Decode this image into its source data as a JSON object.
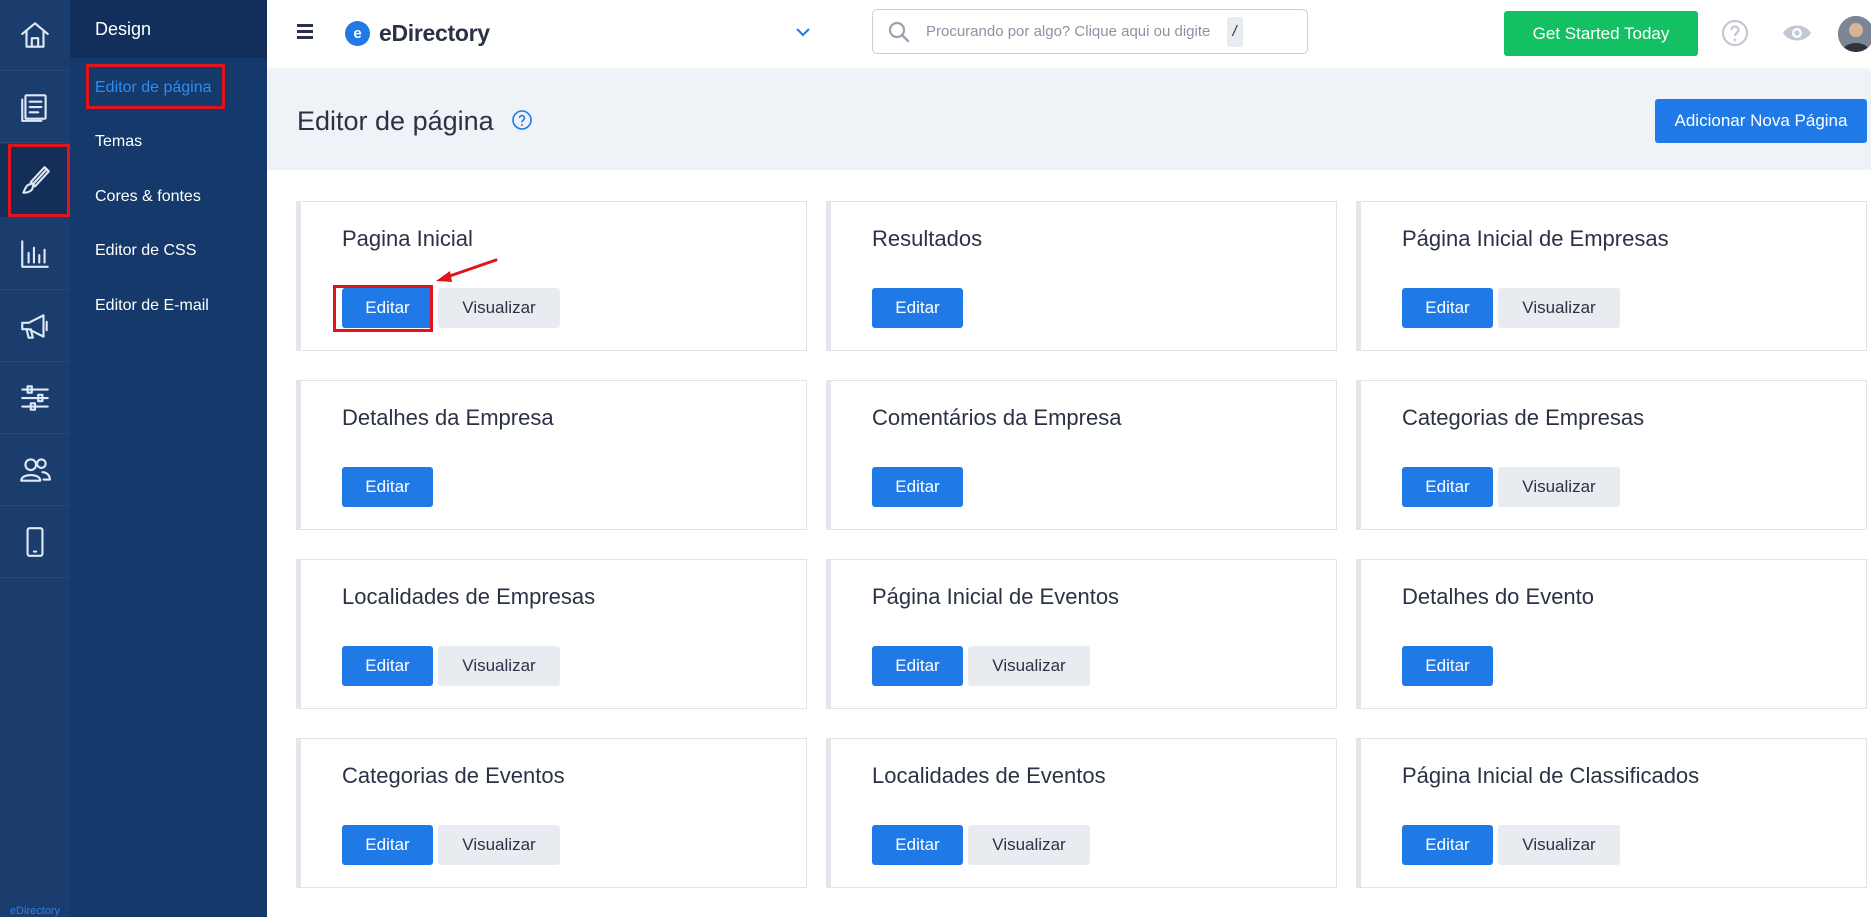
{
  "rail": {
    "items": [
      {
        "icon": "home-icon"
      },
      {
        "icon": "content-icon"
      },
      {
        "icon": "brush-icon",
        "active": true
      },
      {
        "icon": "reports-icon"
      },
      {
        "icon": "megaphone-icon"
      },
      {
        "icon": "settings-sliders-icon"
      },
      {
        "icon": "users-icon"
      },
      {
        "icon": "mobile-icon"
      }
    ],
    "brand_label": "eDirectory"
  },
  "subnav": {
    "title": "Design",
    "items": [
      {
        "label": "Editor de página",
        "active": true
      },
      {
        "label": "Temas"
      },
      {
        "label": "Cores & fontes"
      },
      {
        "label": "Editor de CSS"
      },
      {
        "label": "Editor de E-mail"
      }
    ]
  },
  "topbar": {
    "brand_letter": "e",
    "brand_name": "eDirectory",
    "search_placeholder": "Procurando por algo? Clique aqui ou digite",
    "search_shortcut": "/",
    "cta_label": "Get Started Today",
    "icons": [
      "help-circle-icon",
      "eye-icon",
      "avatar"
    ]
  },
  "page": {
    "title": "Editor de página",
    "add_button": "Adicionar Nova Página"
  },
  "labels": {
    "edit": "Editar",
    "view": "Visualizar"
  },
  "cards": [
    {
      "title": "Pagina Inicial",
      "view": true
    },
    {
      "title": "Resultados",
      "view": false
    },
    {
      "title": "Página Inicial de Empresas",
      "view": true
    },
    {
      "title": "Detalhes da Empresa",
      "view": false
    },
    {
      "title": "Comentários da Empresa",
      "view": false
    },
    {
      "title": "Categorias de Empresas",
      "view": true
    },
    {
      "title": "Localidades de Empresas",
      "view": true
    },
    {
      "title": "Página Inicial de Eventos",
      "view": true
    },
    {
      "title": "Detalhes do Evento",
      "view": false
    },
    {
      "title": "Categorias de Eventos",
      "view": true
    },
    {
      "title": "Localidades de Eventos",
      "view": true
    },
    {
      "title": "Página Inicial de Classificados",
      "view": true
    }
  ],
  "colors": {
    "primary": "#1f7ae8",
    "cta_green": "#13c163",
    "rail_bg": "#1a3d6e",
    "subnav_bg": "#15396a",
    "annotation_red": "#e0141b"
  }
}
